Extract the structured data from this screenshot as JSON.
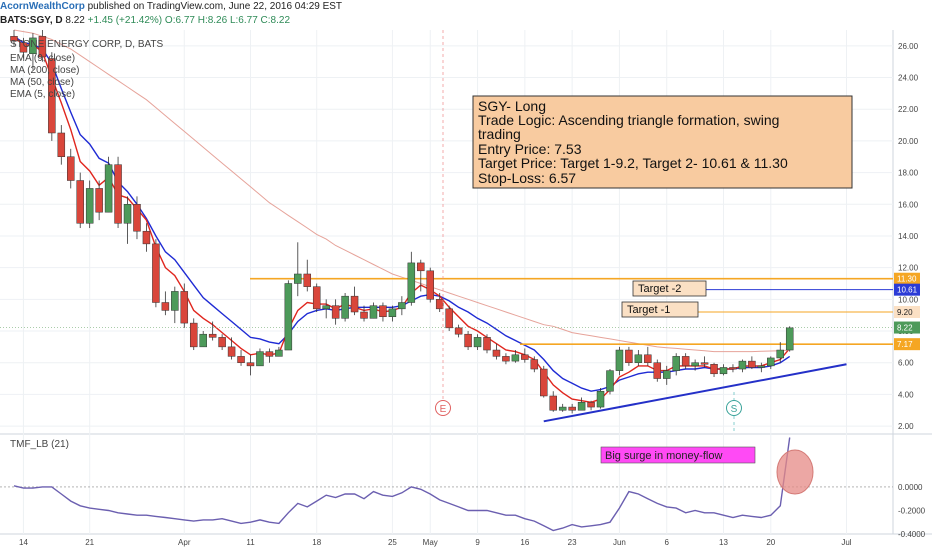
{
  "header": {
    "publisher": "AcornWealthCorp",
    "published_text": "published on TradingView.com, June 22, 2016 04:29 EST",
    "symbol": "BATS:SGY, D",
    "last": "8.22",
    "change": "+1.45 (+21.42%)",
    "ohlc": "O:6.77 H:8.26 L:6.77 C:8.22"
  },
  "legend": {
    "title": "STONE ENERGY CORP, D, BATS",
    "items": [
      "EMA (9, close)",
      "MA (200, close)",
      "MA (50, close)",
      "EMA (5, close)"
    ]
  },
  "annotation": {
    "lines": [
      "SGY- Long",
      "Trade Logic: Ascending triangle formation, swing",
      "trading",
      "Entry Price: 7.53",
      "Target Price: Target 1-9.2, Target 2- 10.61 & 11.30",
      "Stop-Loss: 6.57"
    ]
  },
  "labels": {
    "target1": "Target -1",
    "target2": "Target -2",
    "surge": "Big surge in money-flow",
    "indicator": "TMF_LB (21)",
    "marker_e": "E",
    "marker_s": "S"
  },
  "colors": {
    "up": "#4d9a5a",
    "down": "#d9463b",
    "ema9": "#1f2bd4",
    "ema5": "#e0261e",
    "ma50": "#e6a39a",
    "levels": "#f5a623",
    "target2_line": "#2b3bd6",
    "trendline": "#2430c8",
    "tmf": "#6b5fb0",
    "note_bg": "#f8cba0",
    "surge_bg": "#ff4af5"
  },
  "chart_data": {
    "type": "candlestick",
    "y_axis": {
      "range": [
        1.5,
        27
      ],
      "ticks": [
        "26.00",
        "24.00",
        "22.00",
        "20.00",
        "18.00",
        "16.00",
        "14.00",
        "12.00",
        "10.00",
        "8.00",
        "6.00",
        "4.00",
        "2.00"
      ],
      "tick_values": [
        26,
        24,
        22,
        20,
        18,
        16,
        14,
        12,
        10,
        8,
        6,
        4,
        2
      ]
    },
    "x_axis": {
      "ticks": [
        "14",
        "21",
        "Apr",
        "11",
        "18",
        "25",
        "May",
        "9",
        "16",
        "23",
        "Jun",
        "6",
        "13",
        "20",
        "Jul"
      ]
    },
    "price_labels": [
      "11.30",
      "10.61",
      "9.20",
      "8.22",
      "7.17"
    ],
    "levels": {
      "target2": 11.3,
      "target2b": 10.61,
      "target1": 9.2,
      "resistance": 7.17,
      "current": 8.22
    },
    "candles": [
      [
        26.6,
        27.0,
        26.0,
        26.3
      ],
      [
        26.2,
        26.5,
        25.2,
        25.6
      ],
      [
        25.5,
        26.8,
        24.5,
        26.5
      ],
      [
        26.6,
        27.0,
        25.0,
        25.3
      ],
      [
        25.2,
        25.6,
        20.0,
        20.5
      ],
      [
        20.5,
        21.0,
        18.5,
        19.0
      ],
      [
        19.0,
        19.5,
        17.0,
        17.5
      ],
      [
        17.5,
        18.0,
        14.5,
        14.8
      ],
      [
        14.8,
        17.5,
        14.5,
        17.0
      ],
      [
        17.0,
        17.5,
        15.0,
        15.5
      ],
      [
        15.5,
        19.0,
        15.5,
        18.5
      ],
      [
        18.5,
        19.0,
        14.5,
        14.8
      ],
      [
        14.8,
        16.5,
        13.5,
        16.0
      ],
      [
        16.0,
        16.5,
        13.8,
        14.3
      ],
      [
        14.3,
        14.8,
        13.0,
        13.5
      ],
      [
        13.5,
        13.8,
        9.5,
        9.8
      ],
      [
        9.8,
        10.5,
        9.0,
        9.3
      ],
      [
        9.3,
        10.8,
        8.5,
        10.5
      ],
      [
        10.5,
        11.0,
        8.2,
        8.5
      ],
      [
        8.5,
        8.8,
        6.8,
        7.0
      ],
      [
        7.0,
        8.0,
        7.0,
        7.8
      ],
      [
        7.8,
        8.6,
        7.4,
        7.6
      ],
      [
        7.6,
        7.8,
        6.8,
        7.0
      ],
      [
        7.0,
        7.6,
        6.2,
        6.4
      ],
      [
        6.4,
        6.8,
        5.8,
        6.0
      ],
      [
        6.0,
        6.5,
        5.2,
        5.8
      ],
      [
        5.8,
        6.9,
        5.8,
        6.7
      ],
      [
        6.7,
        6.9,
        6.0,
        6.4
      ],
      [
        6.4,
        7.0,
        6.4,
        6.8
      ],
      [
        6.8,
        11.2,
        6.8,
        11.0
      ],
      [
        11.0,
        13.6,
        10.2,
        11.6
      ],
      [
        11.6,
        12.5,
        10.5,
        10.8
      ],
      [
        10.8,
        11.0,
        9.2,
        9.4
      ],
      [
        9.4,
        10.0,
        8.8,
        9.6
      ],
      [
        9.6,
        10.0,
        8.4,
        8.8
      ],
      [
        8.8,
        10.4,
        8.6,
        10.2
      ],
      [
        10.2,
        10.8,
        9.0,
        9.2
      ],
      [
        9.2,
        9.6,
        8.6,
        8.8
      ],
      [
        8.8,
        9.8,
        8.8,
        9.6
      ],
      [
        9.6,
        9.8,
        8.6,
        8.9
      ],
      [
        8.9,
        9.6,
        8.6,
        9.4
      ],
      [
        9.4,
        10.2,
        9.0,
        9.8
      ],
      [
        9.8,
        13.0,
        9.6,
        12.3
      ],
      [
        12.3,
        12.5,
        10.5,
        11.8
      ],
      [
        11.8,
        12.0,
        9.8,
        10.0
      ],
      [
        10.0,
        10.4,
        9.2,
        9.4
      ],
      [
        9.4,
        9.6,
        8.0,
        8.2
      ],
      [
        8.2,
        8.4,
        7.6,
        7.8
      ],
      [
        7.8,
        8.0,
        6.8,
        7.0
      ],
      [
        7.0,
        7.8,
        6.8,
        7.6
      ],
      [
        7.6,
        7.8,
        6.6,
        6.8
      ],
      [
        6.8,
        7.2,
        6.2,
        6.4
      ],
      [
        6.4,
        6.6,
        5.9,
        6.1
      ],
      [
        6.1,
        6.8,
        6.0,
        6.5
      ],
      [
        6.5,
        6.9,
        6.0,
        6.2
      ],
      [
        6.2,
        6.4,
        5.4,
        5.6
      ],
      [
        5.6,
        5.8,
        3.8,
        3.9
      ],
      [
        3.9,
        4.2,
        2.9,
        3.0
      ],
      [
        3.0,
        3.4,
        2.9,
        3.2
      ],
      [
        3.2,
        3.4,
        2.8,
        3.0
      ],
      [
        3.0,
        3.8,
        3.0,
        3.5
      ],
      [
        3.5,
        3.6,
        3.0,
        3.2
      ],
      [
        3.2,
        4.4,
        3.1,
        4.2
      ],
      [
        4.2,
        5.6,
        4.0,
        5.5
      ],
      [
        5.5,
        7.0,
        5.2,
        6.8
      ],
      [
        6.8,
        7.0,
        5.8,
        6.0
      ],
      [
        6.0,
        6.8,
        5.8,
        6.5
      ],
      [
        6.5,
        7.0,
        5.8,
        6.0
      ],
      [
        6.0,
        6.2,
        4.8,
        5.0
      ],
      [
        5.0,
        5.8,
        4.6,
        5.5
      ],
      [
        5.5,
        6.6,
        5.2,
        6.4
      ],
      [
        6.4,
        6.6,
        5.6,
        5.8
      ],
      [
        5.8,
        6.2,
        5.5,
        6.0
      ],
      [
        6.0,
        6.4,
        5.7,
        5.9
      ],
      [
        5.9,
        6.0,
        5.1,
        5.3
      ],
      [
        5.3,
        5.9,
        5.2,
        5.7
      ],
      [
        5.7,
        5.9,
        5.4,
        5.6
      ],
      [
        5.6,
        6.2,
        5.4,
        6.1
      ],
      [
        6.1,
        6.4,
        5.6,
        5.7
      ],
      [
        5.7,
        6.0,
        5.4,
        5.8
      ],
      [
        5.8,
        6.4,
        5.6,
        6.3
      ],
      [
        6.3,
        7.3,
        6.0,
        6.8
      ],
      [
        6.8,
        8.3,
        6.7,
        8.2
      ]
    ],
    "series": [
      {
        "name": "EMA (9, close)",
        "values": [
          26.6,
          26.2,
          26.1,
          25.8,
          24.9,
          23.3,
          21.8,
          20.4,
          19.8,
          18.9,
          18.6,
          17.4,
          16.8,
          16.0,
          15.1,
          14.0,
          13.0,
          12.5,
          11.7,
          10.9,
          10.1,
          9.6,
          9.1,
          8.6,
          8.1,
          7.6,
          7.5,
          7.3,
          7.2,
          7.8,
          8.6,
          9.1,
          9.3,
          9.4,
          9.3,
          9.4,
          9.5,
          9.5,
          9.5,
          9.5,
          9.5,
          9.6,
          9.9,
          10.2,
          10.3,
          10.2,
          9.9,
          9.5,
          9.2,
          8.8,
          8.5,
          8.1,
          7.7,
          7.4,
          7.1,
          6.8,
          6.2,
          5.5,
          5.0,
          4.7,
          4.4,
          4.2,
          4.3,
          4.5,
          4.9,
          5.1,
          5.3,
          5.4,
          5.4,
          5.4,
          5.5,
          5.6,
          5.6,
          5.7,
          5.6,
          5.6,
          5.6,
          5.7,
          5.7,
          5.7,
          5.8,
          6.0,
          6.4
        ]
      },
      {
        "name": "EMA (5, close)",
        "values": [
          26.6,
          26.0,
          26.1,
          25.6,
          24.0,
          22.4,
          20.7,
          18.7,
          18.1,
          17.2,
          17.7,
          16.6,
          16.4,
          15.7,
          15.0,
          13.3,
          12.0,
          11.5,
          10.5,
          9.3,
          8.8,
          8.4,
          7.9,
          7.4,
          6.9,
          6.5,
          6.6,
          6.5,
          6.6,
          8.1,
          9.3,
          9.8,
          9.7,
          9.7,
          9.4,
          9.7,
          9.5,
          9.3,
          9.4,
          9.2,
          9.3,
          9.5,
          10.4,
          10.9,
          10.6,
          10.2,
          9.5,
          8.9,
          8.3,
          8.0,
          7.6,
          7.2,
          6.8,
          6.7,
          6.5,
          6.2,
          5.4,
          4.6,
          4.1,
          3.7,
          3.6,
          3.5,
          3.7,
          4.3,
          5.1,
          5.4,
          5.8,
          5.8,
          5.5,
          5.5,
          5.8,
          5.8,
          5.8,
          5.8,
          5.6,
          5.6,
          5.6,
          5.8,
          5.8,
          5.8,
          6.0,
          6.2,
          6.9
        ]
      },
      {
        "name": "MA (50, close)",
        "values": [
          27.0,
          26.9,
          26.8,
          26.6,
          26.4,
          26.1,
          25.8,
          25.4,
          25.0,
          24.6,
          24.2,
          23.8,
          23.4,
          23.0,
          22.6,
          22.1,
          21.6,
          21.1,
          20.6,
          20.1,
          19.6,
          19.1,
          18.6,
          18.1,
          17.6,
          17.1,
          16.6,
          16.1,
          15.7,
          15.3,
          14.9,
          14.5,
          14.1,
          13.8,
          13.4,
          13.1,
          12.8,
          12.5,
          12.2,
          11.9,
          11.6,
          11.4,
          11.2,
          11.0,
          10.8,
          10.6,
          10.4,
          10.2,
          10.0,
          9.8,
          9.6,
          9.4,
          9.2,
          9.0,
          8.8,
          8.6,
          8.4,
          8.3,
          8.1,
          7.9,
          7.8,
          7.7,
          7.6,
          7.5,
          7.4,
          7.3,
          7.2,
          7.1,
          7.0,
          6.95,
          6.9,
          6.85,
          6.8,
          6.75,
          6.7,
          6.7,
          6.7,
          6.7,
          6.7,
          6.72,
          6.74,
          6.76,
          6.8
        ]
      },
      {
        "name": "TMF_LB (21)",
        "values": [
          0.01,
          -0.01,
          -0.01,
          0.0,
          0.0,
          -0.06,
          -0.12,
          -0.16,
          -0.18,
          -0.19,
          -0.2,
          -0.22,
          -0.23,
          -0.24,
          -0.24,
          -0.25,
          -0.26,
          -0.27,
          -0.28,
          -0.29,
          -0.28,
          -0.28,
          -0.27,
          -0.29,
          -0.31,
          -0.3,
          -0.28,
          -0.3,
          -0.31,
          -0.22,
          -0.14,
          -0.17,
          -0.12,
          -0.07,
          -0.09,
          -0.06,
          -0.06,
          -0.1,
          -0.04,
          -0.07,
          -0.08,
          -0.05,
          0.0,
          -0.02,
          -0.06,
          -0.11,
          -0.14,
          -0.17,
          -0.2,
          -0.2,
          -0.2,
          -0.22,
          -0.24,
          -0.24,
          -0.27,
          -0.29,
          -0.33,
          -0.37,
          -0.35,
          -0.32,
          -0.34,
          -0.33,
          -0.32,
          -0.3,
          -0.18,
          -0.04,
          -0.06,
          -0.1,
          -0.14,
          -0.17,
          -0.18,
          -0.22,
          -0.2,
          -0.22,
          -0.22,
          -0.24,
          -0.26,
          -0.24,
          -0.25,
          -0.26,
          -0.24,
          -0.16,
          0.42
        ]
      }
    ],
    "trendline": {
      "from": [
        56,
        2.3
      ],
      "to": [
        88,
        5.9
      ]
    },
    "tmf_axis": {
      "range": [
        -0.4,
        0.45
      ],
      "ticks": [
        "0.0000",
        "-0.2000",
        "-0.4000"
      ],
      "tick_values": [
        0,
        -0.2,
        -0.4
      ]
    }
  }
}
